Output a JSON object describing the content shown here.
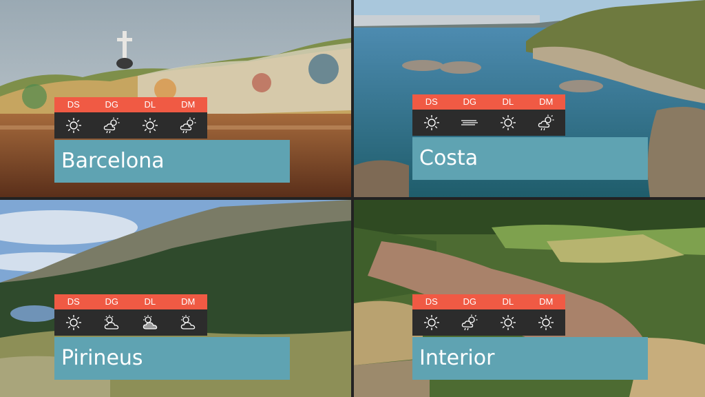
{
  "days": [
    "DS",
    "DG",
    "DL",
    "DM"
  ],
  "regions": [
    {
      "name": "Barcelona",
      "icons": [
        "sun-icon",
        "sun-rain-icon",
        "sun-icon",
        "sun-rain-icon"
      ]
    },
    {
      "name": "Costa",
      "icons": [
        "sun-icon",
        "fog-icon",
        "sun-icon",
        "sun-rain-icon"
      ]
    },
    {
      "name": "Pirineus",
      "icons": [
        "sun-icon",
        "sun-cloud-icon",
        "sun-cloud-filled-icon",
        "sun-cloud-icon"
      ]
    },
    {
      "name": "Interior",
      "icons": [
        "sun-icon",
        "sun-rain-icon",
        "sun-icon",
        "sun-icon"
      ]
    }
  ],
  "colors": {
    "days_bar": "#f05a44",
    "icon_bar": "#2c2c2c",
    "label_bg": "#5fa3b2"
  }
}
